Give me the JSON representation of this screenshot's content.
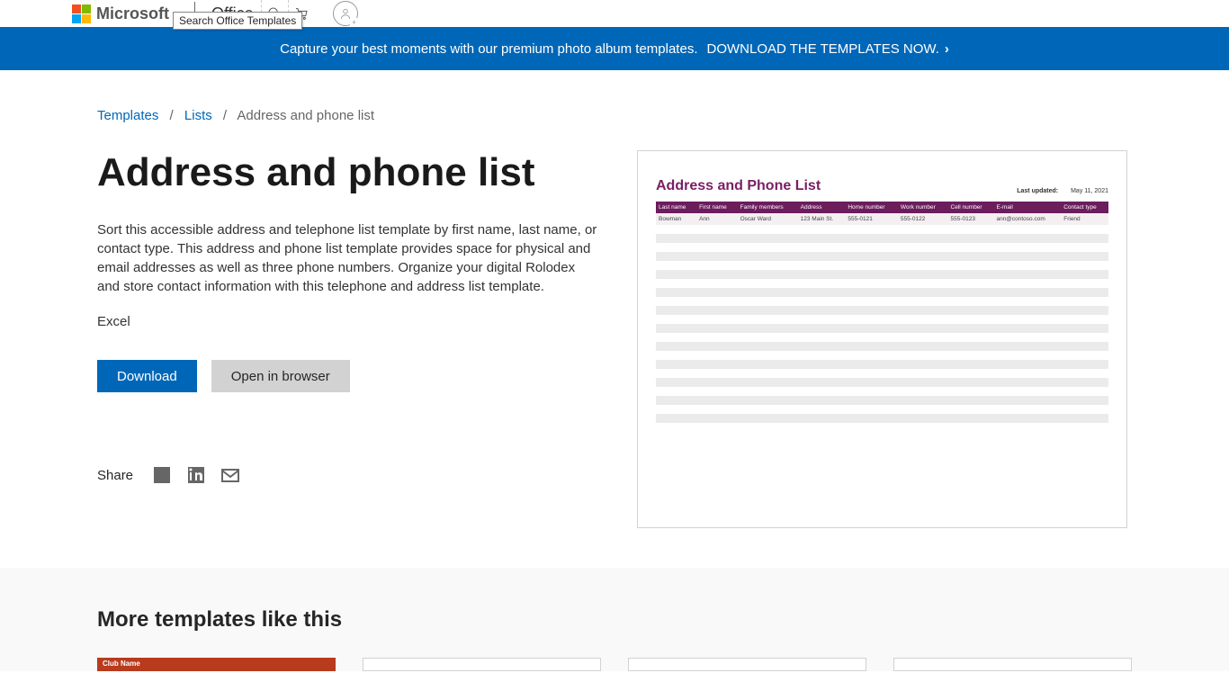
{
  "header": {
    "brand": "Microsoft",
    "product": "Office",
    "tooltip": "Search Office Templates"
  },
  "banner": {
    "text": "Capture your best moments with our premium photo album templates.",
    "link": "DOWNLOAD THE TEMPLATES NOW."
  },
  "breadcrumb": {
    "a": "Templates",
    "b": "Lists",
    "c": "Address and phone list"
  },
  "page": {
    "title": "Address and phone list",
    "description": "Sort this accessible address and telephone list template by first name, last name, or contact type. This address and phone list template provides space for physical and email addresses as well as three phone numbers. Organize your digital Rolodex and store contact information with this telephone and address list template.",
    "app": "Excel",
    "download": "Download",
    "open": "Open in browser",
    "share": "Share"
  },
  "preview": {
    "title": "Address and Phone List",
    "updated_label": "Last updated:",
    "updated_value": "May 11, 2021",
    "headers": [
      "Last name",
      "First name",
      "Family members",
      "Address",
      "Home number",
      "Work number",
      "Cell number",
      "E-mail",
      "Contact type"
    ],
    "row": [
      "Bowman",
      "Ann",
      "Oscar Ward",
      "123 Main St.",
      "555-0121",
      "555-0122",
      "555-0123",
      "ann@contoso.com",
      "Friend"
    ]
  },
  "more": {
    "title": "More templates like this",
    "card_label": "Club Name"
  }
}
